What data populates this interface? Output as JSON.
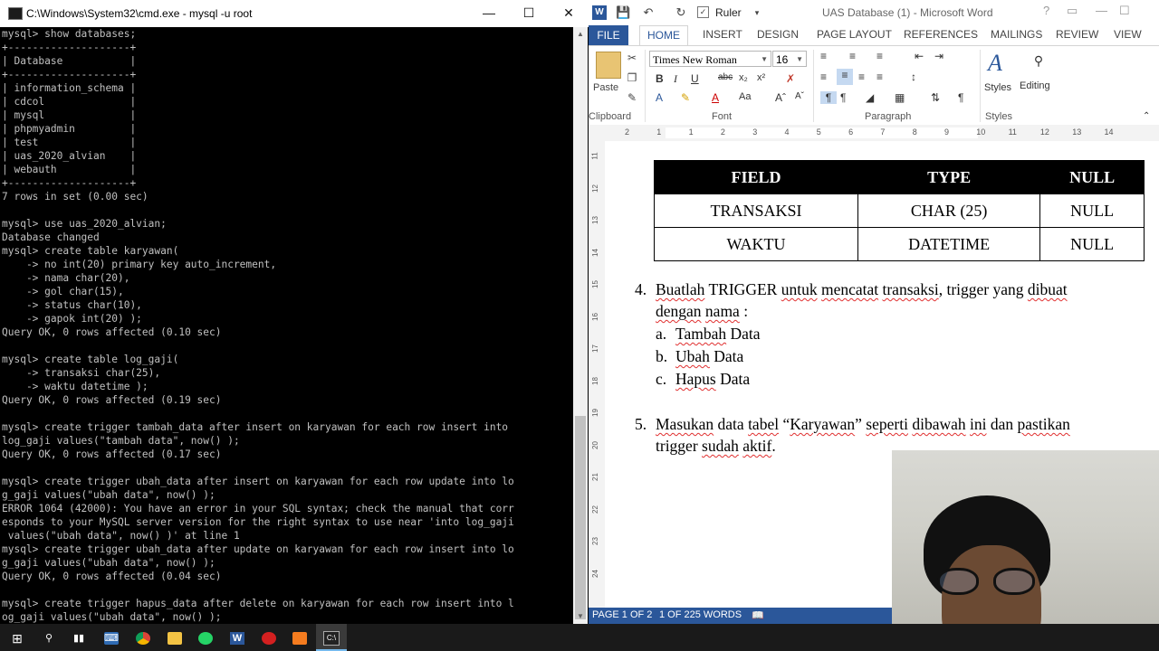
{
  "cmd": {
    "title": "C:\\Windows\\System32\\cmd.exe - mysql  -u root",
    "lines": [
      "mysql> show databases;",
      "+--------------------+",
      "| Database           |",
      "+--------------------+",
      "| information_schema |",
      "| cdcol              |",
      "| mysql              |",
      "| phpmyadmin         |",
      "| test               |",
      "| uas_2020_alvian    |",
      "| webauth            |",
      "+--------------------+",
      "7 rows in set (0.00 sec)",
      "",
      "mysql> use uas_2020_alvian;",
      "Database changed",
      "mysql> create table karyawan(",
      "    -> no int(20) primary key auto_increment,",
      "    -> nama char(20),",
      "    -> gol char(15),",
      "    -> status char(10),",
      "    -> gapok int(20) );",
      "Query OK, 0 rows affected (0.10 sec)",
      "",
      "mysql> create table log_gaji(",
      "    -> transaksi char(25),",
      "    -> waktu datetime );",
      "Query OK, 0 rows affected (0.19 sec)",
      "",
      "mysql> create trigger tambah_data after insert on karyawan for each row insert into",
      "log_gaji values(\"tambah data\", now() );",
      "Query OK, 0 rows affected (0.17 sec)",
      "",
      "mysql> create trigger ubah_data after insert on karyawan for each row update into lo",
      "g_gaji values(\"ubah data\", now() );",
      "ERROR 1064 (42000): You have an error in your SQL syntax; check the manual that corr",
      "esponds to your MySQL server version for the right syntax to use near 'into log_gaji",
      " values(\"ubah data\", now() )' at line 1",
      "mysql> create trigger ubah_data after update on karyawan for each row insert into lo",
      "g_gaji values(\"ubah data\", now() );",
      "Query OK, 0 rows affected (0.04 sec)",
      "",
      "mysql> create trigger hapus_data after delete on karyawan for each row insert into l",
      "og_gaji values(\"ubah data\", now() );"
    ]
  },
  "word": {
    "title": "UAS Database (1) - Microsoft Word",
    "qat_ruler_label": "Ruler",
    "tabs": [
      "FILE",
      "HOME",
      "INSERT",
      "DESIGN",
      "PAGE LAYOUT",
      "REFERENCES",
      "MAILINGS",
      "REVIEW",
      "VIEW"
    ],
    "font_name": "Times New Roman",
    "font_size": "16",
    "groups": {
      "clipboard": "Clipboard",
      "font": "Font",
      "paragraph": "Paragraph",
      "styles": "Styles"
    },
    "paste_label": "Paste",
    "styles_label": "Styles",
    "editing_label": "Editing",
    "table": {
      "headers": [
        "FIELD",
        "TYPE",
        "NULL"
      ],
      "rows": [
        [
          "TRANSAKSI",
          "CHAR (25)",
          "NULL"
        ],
        [
          "WAKTU",
          "DATETIME",
          "NULL"
        ]
      ]
    },
    "item4": {
      "number": "4.",
      "line1_parts": [
        "Buatlah",
        " TRIGGER ",
        "untuk",
        " ",
        "mencatat",
        " ",
        "transaksi",
        ", trigger yang ",
        "dibuat"
      ],
      "line2_parts": [
        "dengan",
        " ",
        "nama",
        " :"
      ],
      "subitems": [
        {
          "letter": "a.",
          "word": "Tambah",
          "rest": " Data"
        },
        {
          "letter": "b.",
          "word": "Ubah",
          "rest": " Data"
        },
        {
          "letter": "c.",
          "word": "Hapus",
          "rest": " Data"
        }
      ]
    },
    "item5": {
      "number": "5.",
      "line1_parts": [
        "Masukan",
        " data ",
        "tabel",
        " “",
        "Karyawan",
        "” ",
        "seperti",
        " ",
        "dibawah",
        " ",
        "ini",
        " dan ",
        "pastikan"
      ],
      "line2_parts": [
        "trigger ",
        "sudah",
        " ",
        "aktif",
        "."
      ]
    },
    "status": {
      "page": "PAGE 1 OF 2",
      "words": "1 OF 225 WORDS"
    }
  },
  "taskbar": {
    "items": [
      "start",
      "search",
      "task-view",
      "keyboard",
      "chrome",
      "file-explorer",
      "whatsapp",
      "word",
      "recorder",
      "xampp",
      "cmd"
    ]
  }
}
